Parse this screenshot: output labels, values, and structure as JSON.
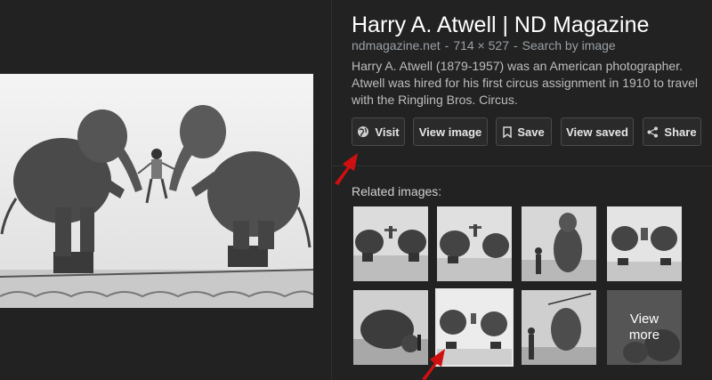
{
  "panel": {
    "title": "Harry A. Atwell | ND Magazine",
    "source": "ndmagazine.net",
    "dimensions": "714 × 527",
    "search_by_image": "Search by image",
    "meta_separator": "-",
    "description": "Harry A. Atwell (1879-1957) was an American photographer. Atwell was hired for his first circus assignment in 1910 to travel with the Ringling Bros. Circus."
  },
  "actions": {
    "visit": "Visit",
    "view_image": "View image",
    "save": "Save",
    "view_saved": "View saved",
    "share": "Share"
  },
  "related": {
    "label": "Related images:",
    "view_more": "View\nmore"
  },
  "icons": [
    "globe-icon",
    "bookmark-icon",
    "share-icon",
    "red-arrow-annotation"
  ],
  "colors": {
    "background": "#222222",
    "button_border": "#4a4a4a",
    "annotation_arrow": "#d01010"
  }
}
